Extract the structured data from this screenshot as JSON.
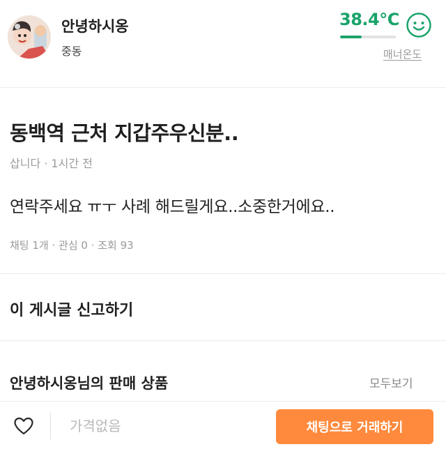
{
  "profile": {
    "username": "안녕하시옹",
    "location": "중동",
    "manner": {
      "temperature": "38.4°C",
      "level": 0.384,
      "label": "매너온도",
      "color": "#1aa36a"
    }
  },
  "post": {
    "title": "동백역 근처 지갑주우신분..",
    "meta": "삽니다 · 1시간 전",
    "body": "연락주세요 ㅠㅜ 사례 해드릴게요..소중한거에요..",
    "stats": "채팅 1개 · 관심 0 · 조회 93"
  },
  "report": {
    "label": "이 게시글 신고하기"
  },
  "seller_section": {
    "title": "안녕하시옹님의 판매 상품",
    "see_all": "모두보기"
  },
  "bottom_bar": {
    "price": "가격없음",
    "chat_button": "채팅으로 거래하기",
    "button_color": "#ff8a3d"
  },
  "icons": {
    "avatar": "cartoon-avatar",
    "manner": "smiley-face-icon",
    "like": "heart-outline-icon"
  }
}
